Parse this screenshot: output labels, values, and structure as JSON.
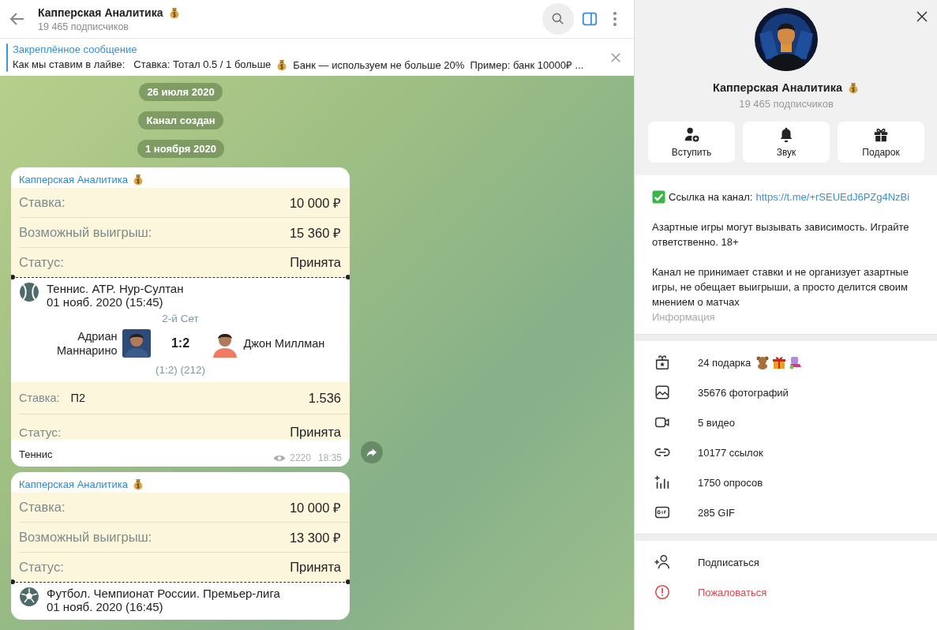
{
  "header": {
    "title": "Капперская Аналитика",
    "subtitle": "19 465 подписчиков"
  },
  "pinned": {
    "label": "Закреплённое сообщение",
    "text_before": "Как мы ставим в лайве:   Ставка: Тотал 0.5 / 1 больше",
    "text_after": "Банк — используем не больше 20%  Пример: банк 10000₽ ..."
  },
  "service_messages": [
    "26 июля 2020",
    "Канал создан",
    "1 ноября 2020"
  ],
  "messages": [
    {
      "author": "Капперская Аналитика",
      "rows": [
        {
          "label": "Ставка:",
          "value": "10 000 ₽"
        },
        {
          "label": "Возможный выигрыш:",
          "value": "15 360 ₽"
        },
        {
          "label": "Статус:",
          "value": "Принята"
        }
      ],
      "event": {
        "kind": "tennis",
        "title": "Теннис. ATP. Нур-Султан",
        "date": "01 нояб. 2020 (15:45)",
        "period": "2-й Сет",
        "player1": "Адриан\nМаннарино",
        "score": "1:2",
        "player2": "Джон Миллман",
        "detail": "(1:2) (212)"
      },
      "stake": {
        "label": "Ставка:",
        "pick": "П2",
        "odds": "1.536"
      },
      "status": {
        "label": "Статус:",
        "value": "Принята"
      },
      "caption": "Теннис",
      "views": "2220",
      "time": "18:35"
    },
    {
      "author": "Капперская Аналитика",
      "rows": [
        {
          "label": "Ставка:",
          "value": "10 000 ₽"
        },
        {
          "label": "Возможный выигрыш:",
          "value": "13 300 ₽"
        },
        {
          "label": "Статус:",
          "value": "Принята"
        }
      ],
      "event": {
        "kind": "football",
        "title": "Футбол. Чемпионат России. Премьер-лига",
        "date": "01 нояб. 2020 (16:45)"
      }
    }
  ],
  "profile": {
    "name": "Капперская Аналитика",
    "subtitle": "19 465 подписчиков",
    "actions": [
      {
        "kind": "join",
        "label": "Вступить"
      },
      {
        "kind": "sound",
        "label": "Звук"
      },
      {
        "kind": "gift",
        "label": "Подарок"
      }
    ],
    "link_label": "Ссылка на канал:",
    "link": "https://t.me/+rSEUEdJ6PZg4NzBi",
    "paragraphs": [
      "Азартные игры могут вызывать зависимость. Играйте ответственно. 18+",
      "Канал не принимает ставки и не организует азартные игры, не обещает выигрыши, а просто делится своим мнением о матчах"
    ],
    "info_caption": "Информация",
    "stats": [
      {
        "kind": "gifts",
        "text": "24 подарка"
      },
      {
        "kind": "photos",
        "text": "35676 фотографий"
      },
      {
        "kind": "videos",
        "text": "5 видео"
      },
      {
        "kind": "links",
        "text": "10177 ссылок"
      },
      {
        "kind": "polls",
        "text": "1750 опросов"
      },
      {
        "kind": "gifs",
        "text": "285 GIF"
      }
    ],
    "commands": [
      {
        "kind": "subscribe",
        "text": "Подписаться"
      },
      {
        "kind": "report",
        "text": "Пожаловаться"
      }
    ]
  }
}
